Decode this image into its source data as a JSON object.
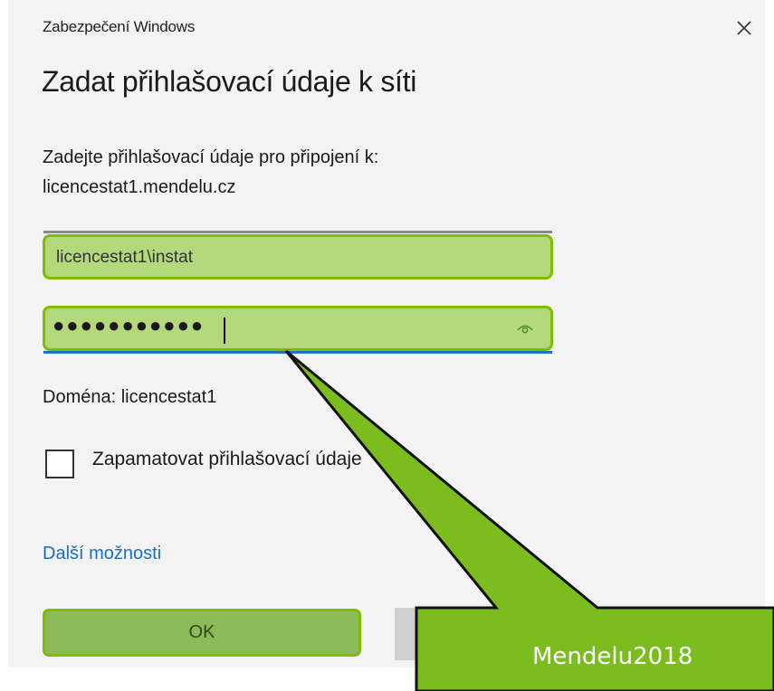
{
  "window": {
    "title": "Zabezpečení Windows"
  },
  "dialog": {
    "heading": "Zadat přihlašovací údaje k síti",
    "description_line1": "Zadejte přihlašovací údaje pro připojení k:",
    "description_line2": "licencestat1.mendelu.cz",
    "username": {
      "value": "licencestat1\\instat"
    },
    "password": {
      "masked_value": "●●●●●●●●●●●"
    },
    "domain_text": "Doména: licencestat1",
    "remember_label": "Zapamatovat přihlašovací údaje",
    "remember_checked": false,
    "more_options_label": "Další možnosti",
    "ok_label": "OK",
    "cancel_label": ""
  },
  "annotation": {
    "callout_text": "Mendelu2018"
  },
  "icons": {
    "close": "close-icon",
    "reveal_password": "eye-icon"
  },
  "colors": {
    "highlight_fill": "#b3d97c",
    "highlight_border": "#80bc00",
    "callout_fill": "#7bbd1f",
    "link": "#1a6fc4"
  }
}
